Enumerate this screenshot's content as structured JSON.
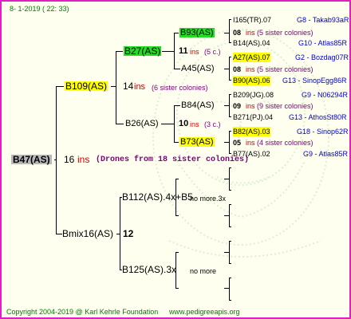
{
  "header": {
    "date": "8-  1-2019 ( 22: 33)"
  },
  "footer": {
    "copyright": "Copyright 2004-2019 @ Karl Kehrle Foundation",
    "website": "www.pedigreeapis.org"
  },
  "root": {
    "id": "B47(AS)",
    "count": "16",
    "ins": "ins",
    "note": "(Drones from 18 sister colonies)"
  },
  "sire": {
    "id": "B109(AS)",
    "count": "14",
    "ins": "ins",
    "note": "(6 sister colonies)"
  },
  "dam": {
    "id": "Bmix16(AS)",
    "count": "12"
  },
  "sire_sire": {
    "id": "B27(AS)"
  },
  "sire_dam": {
    "id": "B26(AS)",
    "count": "10",
    "ins": "ins",
    "note": "(3 c.)"
  },
  "ss_sire": {
    "id": "B93(AS)",
    "count": "11",
    "ins": "ins",
    "note": "(5 c.)"
  },
  "ss_dam": {
    "id": "A45(AS)"
  },
  "sd_sire": {
    "id": "B84(AS)"
  },
  "sd_dam": {
    "id": "B73(AS)"
  },
  "dam_sire": {
    "id": "B112(AS).4x+B5",
    "note": "no more.3x"
  },
  "dam_dam": {
    "id": "B125(AS).3x",
    "note": "no more"
  },
  "right": [
    {
      "id": "I165(TR).07",
      "code": "G8 - Takab93aR"
    },
    {
      "count": "08",
      "ins": "ins",
      "note": "(5 sister colonies)"
    },
    {
      "id": "B14(AS).04",
      "code": "G10 - Atlas85R"
    },
    {
      "id": "A27(AS).07",
      "code": "G2 - Bozdag07R"
    },
    {
      "count": "08",
      "ins": "ins",
      "note": "(5 sister colonies)"
    },
    {
      "id": "B90(AS).06",
      "code": "G13 - SinopEgg86R"
    },
    {
      "id": "B209(JG).08",
      "code": "G9 - N06294R"
    },
    {
      "count": "09",
      "ins": "ins",
      "note": "(9 sister colonies)"
    },
    {
      "id": "B271(PJ).04",
      "code": "G13 - AthosSt80R"
    },
    {
      "id": "B82(AS).03",
      "code": "G18 - Sinop62R"
    },
    {
      "count": "05",
      "ins": "ins",
      "note": "(4 sister colonies)"
    },
    {
      "id": "B77(AS).02",
      "code": "G9 - Atlas85R"
    }
  ],
  "colors": {
    "border": "#e020c0",
    "background": "#fffff0",
    "highlight_yellow": "#ffff00",
    "highlight_green": "#22dd22",
    "ins_red": "#cc0000",
    "note_purple": "#800080",
    "code_blue": "#0000cc",
    "footer_green": "#008000"
  }
}
